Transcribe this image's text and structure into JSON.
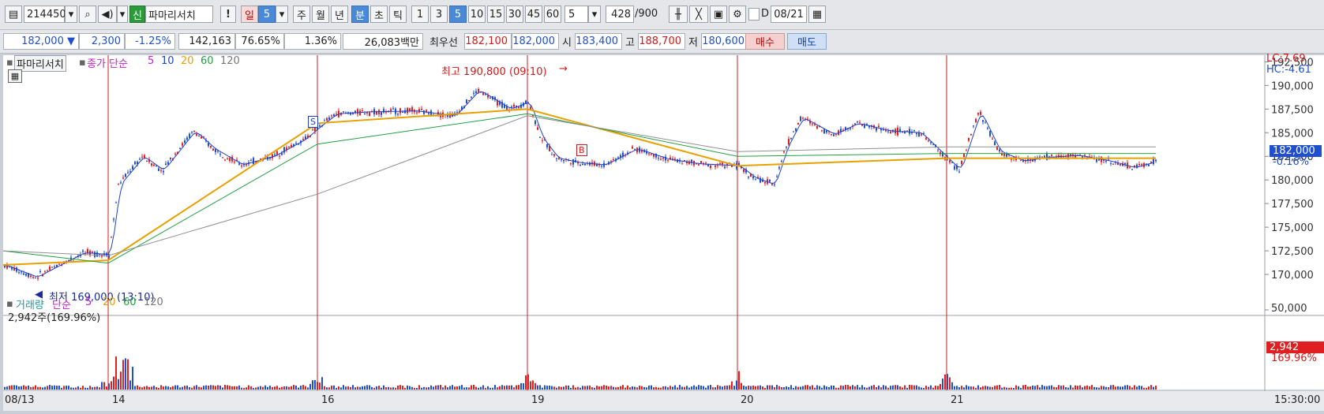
{
  "toolbar": {
    "stock_code": "214450",
    "credit_badge": "신",
    "stock_name": "파마리서치",
    "alert_label": "!",
    "period_day": "일",
    "period_day_count": "5",
    "period_week": "주",
    "period_month": "월",
    "period_year": "년",
    "period_minute": "분",
    "period_second": "초",
    "period_tick": "틱",
    "intervals": [
      "1",
      "3",
      "5",
      "10",
      "15",
      "30",
      "45",
      "60"
    ],
    "selected_interval": "5",
    "interval_value": "5",
    "count_value": "428",
    "count_max": "/900",
    "date_prefix": "D",
    "date_value": "08/21"
  },
  "info": {
    "price": "182,000",
    "change": "2,300",
    "change_pct": "-1.25%",
    "volume": "142,163",
    "volume_ratio": "76.65%",
    "turnover": "1.36%",
    "amount": "26,083백만",
    "best_quote_label": "최우선",
    "best_ask": "182,100",
    "best_bid": "182,000",
    "open_label": "시",
    "open": "183,400",
    "high_label": "고",
    "high": "188,700",
    "low_label": "저",
    "low": "180,600",
    "buy_button": "매수",
    "sell_button": "매도"
  },
  "price_panel": {
    "indicator_name": "파마리서치",
    "ma_label": "종가 단순",
    "ma_periods": [
      "5",
      "10",
      "20",
      "60",
      "120"
    ],
    "high_annotation": "최고 190,800 (09:10)",
    "low_annotation": "최저 169,000 (13:10)",
    "lc_label": "LC:7.69",
    "hc_label": "HC:-4.61",
    "current_price_tag": "182,000",
    "current_pct_tag": "-0.16%",
    "signal_s": "S",
    "signal_b": "B"
  },
  "volume_panel": {
    "title": "거래량",
    "ma_label": "단순",
    "ma_periods": [
      "5",
      "20",
      "60",
      "120"
    ],
    "current": "2,942주(169.96%)",
    "volume_tag": "2,942",
    "volume_pct_tag": "169.96%",
    "y_tick": "50,000"
  },
  "time_axis": {
    "dates": [
      "08/13",
      "14",
      "16",
      "19",
      "20",
      "21"
    ],
    "last_time": "15:30:00"
  },
  "colors": {
    "up": "#e02020",
    "down": "#1f4fd0",
    "ma5": "#2040d0",
    "ma20": "#e8a000",
    "ma60": "#20a040",
    "ma120": "#909090",
    "session_line": "#d81818"
  },
  "chart_data": {
    "type": "line",
    "title": "",
    "xlabel": "",
    "ylabel": "",
    "ylim": [
      168500,
      192000
    ],
    "y_ticks": [
      "192,500",
      "190,000",
      "187,500",
      "185,000",
      "182,500",
      "180,000",
      "177,500",
      "175,000",
      "172,500",
      "170,000"
    ],
    "x": [
      "08/13",
      "14",
      "16",
      "19",
      "20",
      "21"
    ],
    "series": [
      {
        "name": "종가",
        "values": [
          170500,
          172800,
          186500,
          186000,
          180500,
          182000
        ]
      },
      {
        "name": "20",
        "values": [
          171000,
          171500,
          186000,
          187500,
          181500,
          182300
        ]
      },
      {
        "name": "60",
        "values": [
          172500,
          171200,
          183800,
          187000,
          182500,
          182800
        ]
      },
      {
        "name": "120",
        "values": [
          172500,
          172000,
          178500,
          186800,
          183000,
          183500
        ]
      }
    ]
  }
}
